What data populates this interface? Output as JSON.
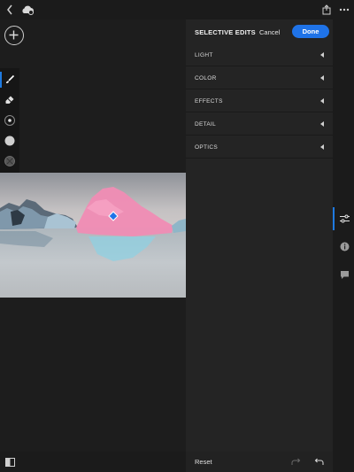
{
  "topbar": {
    "back_icon": "chevron-left-icon",
    "cloud_icon": "cloud-sync-icon",
    "share_icon": "share-icon",
    "more_icon": "more-icon"
  },
  "canvas": {
    "add_icon": "plus-icon",
    "tools": [
      "brush-icon",
      "eraser-icon",
      "brush-size-icon",
      "feather-icon",
      "flow-icon"
    ]
  },
  "panel": {
    "title": "SELECTIVE EDITS",
    "cancel_label": "Cancel",
    "done_label": "Done",
    "sections": [
      {
        "label": "LIGHT"
      },
      {
        "label": "COLOR"
      },
      {
        "label": "EFFECTS"
      },
      {
        "label": "DETAIL"
      },
      {
        "label": "OPTICS"
      }
    ]
  },
  "siderail": {
    "icons": [
      "sliders-icon",
      "info-icon",
      "comment-icon"
    ]
  },
  "bottom": {
    "reset_label": "Reset",
    "compare_icon": "compare-icon",
    "redo_icon": "redo-icon",
    "undo_icon": "undo-icon"
  },
  "colors": {
    "accent": "#1f73e8",
    "mask_overlay": "#f08cb4"
  }
}
